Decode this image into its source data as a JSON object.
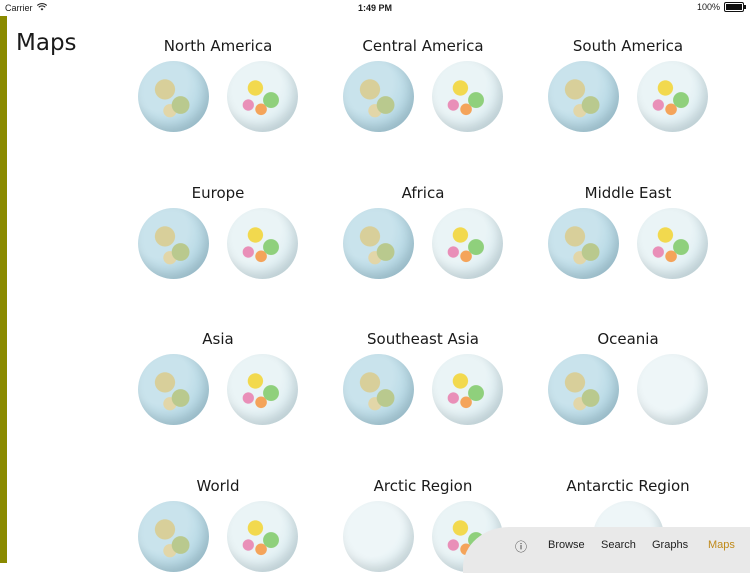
{
  "status_bar": {
    "carrier": "Carrier",
    "time": "1:49 PM",
    "battery": "100%",
    "battery_level": 1.0
  },
  "page": {
    "title": "Maps"
  },
  "colors": {
    "accent_strip": "#8a8a00",
    "active_tab": "#c08a1a"
  },
  "regions": [
    {
      "label": "North America"
    },
    {
      "label": "Central America"
    },
    {
      "label": "South America"
    },
    {
      "label": "Europe"
    },
    {
      "label": "Africa"
    },
    {
      "label": "Middle East"
    },
    {
      "label": "Asia"
    },
    {
      "label": "Southeast Asia"
    },
    {
      "label": "Oceania"
    },
    {
      "label": "World"
    },
    {
      "label": "Arctic Region"
    },
    {
      "label": "Antarctic Region"
    }
  ],
  "tab_bar": {
    "info_icon": "info-icon",
    "tabs": [
      {
        "label": "Browse"
      },
      {
        "label": "Search"
      },
      {
        "label": "Graphs"
      },
      {
        "label": "Maps",
        "active": true
      }
    ]
  }
}
